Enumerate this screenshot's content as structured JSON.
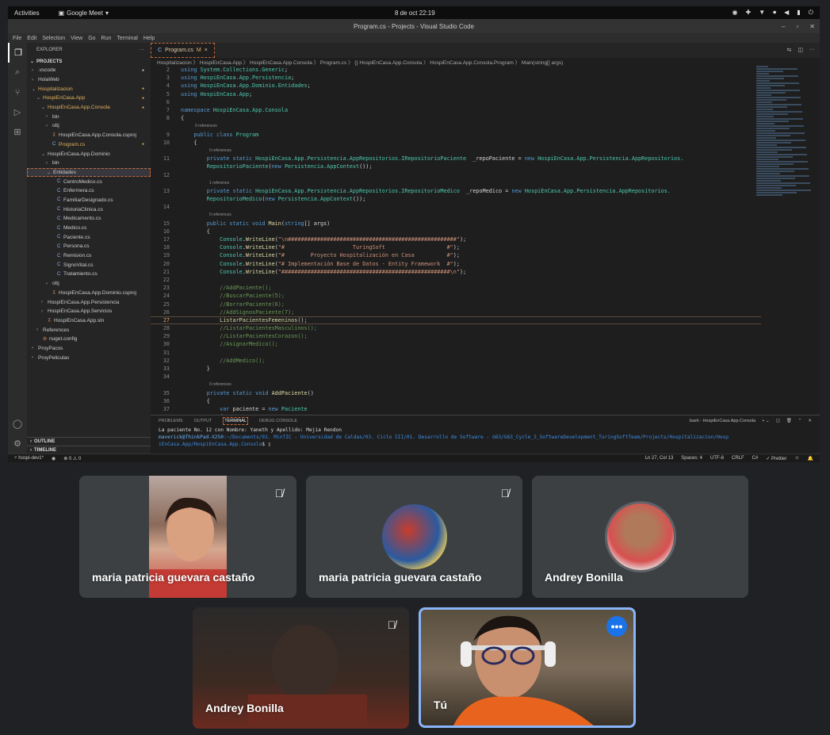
{
  "gnome": {
    "activities": "Activities",
    "app_name": "Google Meet",
    "clock": "8 de oct  22:19"
  },
  "window": {
    "title": "Program.cs - Projects - Visual Studio Code"
  },
  "menu": [
    "File",
    "Edit",
    "Selection",
    "View",
    "Go",
    "Run",
    "Terminal",
    "Help"
  ],
  "sidebar": {
    "header": "EXPLORER",
    "section": "PROJECTS",
    "items": [
      {
        "label": ".vscode",
        "indent": 1,
        "caret": "›",
        "icon": "",
        "color": "#ccc",
        "dot": true
      },
      {
        "label": "HolaWeb",
        "indent": 1,
        "caret": "›",
        "icon": "",
        "color": "#ccc",
        "dot": false
      },
      {
        "label": "Hospitalizacion",
        "indent": 1,
        "caret": "⌄",
        "icon": "",
        "color": "#e2b35c",
        "dot": true
      },
      {
        "label": "HospiEnCasa.App",
        "indent": 2,
        "caret": "⌄",
        "icon": "",
        "color": "#e2b35c",
        "dot": true
      },
      {
        "label": "HospiEnCasa.App.Consola",
        "indent": 3,
        "caret": "⌄",
        "icon": "",
        "color": "#e2b35c",
        "dot": true
      },
      {
        "label": "bin",
        "indent": 4,
        "caret": "›",
        "icon": "",
        "color": "#ccc",
        "dot": false
      },
      {
        "label": "obj",
        "indent": 4,
        "caret": "›",
        "icon": "",
        "color": "#ccc",
        "dot": false
      },
      {
        "label": "HospiEnCasa.App.Consola.csproj",
        "indent": 4,
        "caret": "",
        "icon": "⊼",
        "color": "#ccc",
        "dot": false
      },
      {
        "label": "Program.cs",
        "indent": 4,
        "caret": "",
        "icon": "C",
        "color": "#e2b35c",
        "dot": true
      },
      {
        "label": "HospiEnCasa.App.Dominio",
        "indent": 3,
        "caret": "⌄",
        "icon": "",
        "color": "#ccc",
        "dot": false
      },
      {
        "label": "bin",
        "indent": 4,
        "caret": "›",
        "icon": "",
        "color": "#ccc",
        "dot": false
      },
      {
        "label": "Entidades",
        "indent": 4,
        "caret": "⌄",
        "icon": "",
        "color": "#ccc",
        "dot": false,
        "sel": true
      },
      {
        "label": "CentroMedico.cs",
        "indent": 5,
        "caret": "",
        "icon": "C",
        "color": "#ccc",
        "dot": false
      },
      {
        "label": "Enfermera.cs",
        "indent": 5,
        "caret": "",
        "icon": "C",
        "color": "#ccc",
        "dot": false
      },
      {
        "label": "FamiliarDesignado.cs",
        "indent": 5,
        "caret": "",
        "icon": "C",
        "color": "#ccc",
        "dot": false
      },
      {
        "label": "HistoriaClinica.cs",
        "indent": 5,
        "caret": "",
        "icon": "C",
        "color": "#ccc",
        "dot": false
      },
      {
        "label": "Medicamento.cs",
        "indent": 5,
        "caret": "",
        "icon": "C",
        "color": "#ccc",
        "dot": false
      },
      {
        "label": "Medico.cs",
        "indent": 5,
        "caret": "",
        "icon": "C",
        "color": "#ccc",
        "dot": false
      },
      {
        "label": "Paciente.cs",
        "indent": 5,
        "caret": "",
        "icon": "C",
        "color": "#ccc",
        "dot": false
      },
      {
        "label": "Persona.cs",
        "indent": 5,
        "caret": "",
        "icon": "C",
        "color": "#ccc",
        "dot": false
      },
      {
        "label": "Remision.cs",
        "indent": 5,
        "caret": "",
        "icon": "C",
        "color": "#ccc",
        "dot": false
      },
      {
        "label": "SignoVital.cs",
        "indent": 5,
        "caret": "",
        "icon": "C",
        "color": "#ccc",
        "dot": false
      },
      {
        "label": "Tratamiento.cs",
        "indent": 5,
        "caret": "",
        "icon": "C",
        "color": "#ccc",
        "dot": false
      },
      {
        "label": "obj",
        "indent": 4,
        "caret": "›",
        "icon": "",
        "color": "#ccc",
        "dot": false
      },
      {
        "label": "HospiEnCasa.App.Dominio.csproj",
        "indent": 4,
        "caret": "",
        "icon": "⊼",
        "color": "#ccc",
        "dot": false
      },
      {
        "label": "HospiEnCasa.App.Persistencia",
        "indent": 3,
        "caret": "›",
        "icon": "",
        "color": "#ccc",
        "dot": false
      },
      {
        "label": "HospiEnCasa.App.Servicios",
        "indent": 3,
        "caret": "›",
        "icon": "",
        "color": "#ccc",
        "dot": false
      },
      {
        "label": "HospiEnCasa.App.sln",
        "indent": 3,
        "caret": "",
        "icon": "⊼",
        "color": "#ccc",
        "dot": false
      },
      {
        "label": "References",
        "indent": 2,
        "caret": "›",
        "icon": "",
        "color": "#ccc",
        "dot": false
      },
      {
        "label": "nuget.config",
        "indent": 2,
        "caret": "",
        "icon": "⚙",
        "color": "#ccc",
        "dot": false
      },
      {
        "label": "ProyPacos",
        "indent": 1,
        "caret": "›",
        "icon": "",
        "color": "#ccc",
        "dot": false
      },
      {
        "label": "ProyPeliculas",
        "indent": 1,
        "caret": "›",
        "icon": "",
        "color": "#ccc",
        "dot": false
      }
    ],
    "outline": "OUTLINE",
    "timeline": "TIMELINE"
  },
  "editor": {
    "tab_label": "Program.cs",
    "tab_mod": "M",
    "breadcrumb": "Hospitalizacion 〉 HospiEnCasa.App 〉 HospiEnCasa.App.Consola 〉 Program.cs 〉 {} HospiEnCasa.App.Consola 〉 HospiEnCasa.App.Consola.Program 〉 Main(string[] args)",
    "lines": [
      {
        "n": "2",
        "t": [
          [
            "kw",
            "using "
          ],
          [
            "ty",
            "System.Collections.Generic"
          ],
          [
            "",
            "; "
          ]
        ]
      },
      {
        "n": "3",
        "t": [
          [
            "kw",
            "using "
          ],
          [
            "ty",
            "HospiEnCasa.App.Persistencia"
          ],
          [
            "",
            ";"
          ]
        ]
      },
      {
        "n": "4",
        "t": [
          [
            "kw",
            "using "
          ],
          [
            "ty",
            "HospiEnCasa.App.Dominio.Entidades"
          ],
          [
            "",
            ";"
          ]
        ]
      },
      {
        "n": "5",
        "t": [
          [
            "kw",
            "using "
          ],
          [
            "ty",
            "HospiEnCasa.App"
          ],
          [
            "",
            ";"
          ]
        ]
      },
      {
        "n": "6",
        "t": [
          [
            "",
            ""
          ]
        ]
      },
      {
        "n": "7",
        "t": [
          [
            "kw",
            "namespace "
          ],
          [
            "ty",
            "HospiEnCasa.App.Consola"
          ]
        ]
      },
      {
        "n": "8",
        "t": [
          [
            "",
            "{"
          ]
        ]
      },
      {
        "n": "",
        "ref": "0 references",
        "pad": 3
      },
      {
        "n": "9",
        "t": [
          [
            "",
            "    "
          ],
          [
            "kw",
            "public class "
          ],
          [
            "ty",
            "Program"
          ]
        ]
      },
      {
        "n": "10",
        "t": [
          [
            "",
            "    {"
          ]
        ]
      },
      {
        "n": "",
        "ref": "0 references",
        "pad": 6
      },
      {
        "n": "11",
        "t": [
          [
            "",
            "        "
          ],
          [
            "kw",
            "private static "
          ],
          [
            "ty",
            "HospiEnCasa.App.Persistencia.AppRepositorios.IRepositorioPaciente"
          ],
          [
            "",
            "  _repoPaciente = "
          ],
          [
            "kw",
            "new "
          ],
          [
            "ty",
            "HospiEnCasa.App.Persistencia.AppRepositorios."
          ]
        ]
      },
      {
        "n": "",
        "t": [
          [
            "",
            "        "
          ],
          [
            "ty",
            "RepositorioPaciente"
          ],
          [
            "",
            "("
          ],
          [
            "kw",
            "new "
          ],
          [
            "ty",
            "Persistencia.AppContext"
          ],
          [
            "",
            "());"
          ]
        ]
      },
      {
        "n": "12",
        "t": [
          [
            "",
            ""
          ]
        ]
      },
      {
        "n": "",
        "ref": "1 reference",
        "pad": 6
      },
      {
        "n": "13",
        "t": [
          [
            "",
            "        "
          ],
          [
            "kw",
            "private static "
          ],
          [
            "ty",
            "HospiEnCasa.App.Persistencia.AppRepositorios.IRepositorioMedico"
          ],
          [
            "",
            "  _repoMedico = "
          ],
          [
            "kw",
            "new "
          ],
          [
            "ty",
            "HospiEnCasa.App.Persistencia.AppRepositorios."
          ]
        ]
      },
      {
        "n": "",
        "t": [
          [
            "",
            "        "
          ],
          [
            "ty",
            "RepositorioMedico"
          ],
          [
            "",
            "("
          ],
          [
            "kw",
            "new "
          ],
          [
            "ty",
            "Persistencia.AppContext"
          ],
          [
            "",
            "());"
          ]
        ]
      },
      {
        "n": "14",
        "t": [
          [
            "",
            ""
          ]
        ]
      },
      {
        "n": "",
        "ref": "0 references",
        "pad": 6
      },
      {
        "n": "15",
        "t": [
          [
            "",
            "        "
          ],
          [
            "kw",
            "public static void "
          ],
          [
            "fn",
            "Main"
          ],
          [
            "",
            "("
          ],
          [
            "kw",
            "string"
          ],
          [
            "",
            "[] args)"
          ]
        ]
      },
      {
        "n": "16",
        "t": [
          [
            "",
            "        {"
          ]
        ]
      },
      {
        "n": "17",
        "t": [
          [
            "",
            "            "
          ],
          [
            "ty",
            "Console"
          ],
          [
            "",
            "."
          ],
          [
            "fn",
            "WriteLine"
          ],
          [
            "",
            "("
          ],
          [
            "st",
            "\"\\n####################################################\""
          ],
          [
            "",
            ");"
          ]
        ]
      },
      {
        "n": "18",
        "t": [
          [
            "",
            "            "
          ],
          [
            "ty",
            "Console"
          ],
          [
            "",
            "."
          ],
          [
            "fn",
            "WriteLine"
          ],
          [
            "",
            "("
          ],
          [
            "st",
            "\"#                     TuringSoft                   #\""
          ],
          [
            "",
            ");"
          ]
        ]
      },
      {
        "n": "19",
        "t": [
          [
            "",
            "            "
          ],
          [
            "ty",
            "Console"
          ],
          [
            "",
            "."
          ],
          [
            "fn",
            "WriteLine"
          ],
          [
            "",
            "("
          ],
          [
            "st",
            "\"#        Proyecto Hospitalización en Casa          #\""
          ],
          [
            "",
            ");"
          ]
        ]
      },
      {
        "n": "20",
        "t": [
          [
            "",
            "            "
          ],
          [
            "ty",
            "Console"
          ],
          [
            "",
            "."
          ],
          [
            "fn",
            "WriteLine"
          ],
          [
            "",
            "("
          ],
          [
            "st",
            "\"# Implementación Base de Datos - Entity Framework  #\""
          ],
          [
            "",
            ");"
          ]
        ]
      },
      {
        "n": "21",
        "t": [
          [
            "",
            "            "
          ],
          [
            "ty",
            "Console"
          ],
          [
            "",
            "."
          ],
          [
            "fn",
            "WriteLine"
          ],
          [
            "",
            "("
          ],
          [
            "st",
            "\"####################################################\\n\""
          ],
          [
            "",
            ");"
          ]
        ]
      },
      {
        "n": "22",
        "t": [
          [
            "",
            ""
          ]
        ]
      },
      {
        "n": "23",
        "t": [
          [
            "",
            "            "
          ],
          [
            "cm",
            "//AddPaciente();"
          ]
        ]
      },
      {
        "n": "24",
        "t": [
          [
            "",
            "            "
          ],
          [
            "cm",
            "//BuscarPaciente(5);"
          ]
        ]
      },
      {
        "n": "25",
        "t": [
          [
            "",
            "            "
          ],
          [
            "cm",
            "//BorrarPaciente(6);"
          ]
        ]
      },
      {
        "n": "26",
        "t": [
          [
            "",
            "            "
          ],
          [
            "cm",
            "//AddSignosPaciente(7);"
          ]
        ]
      },
      {
        "n": "27",
        "t": [
          [
            "",
            "            "
          ],
          [
            "fn",
            "ListarPacientesFemeninos"
          ],
          [
            "",
            "();"
          ]
        ],
        "hl": true
      },
      {
        "n": "28",
        "t": [
          [
            "",
            "            "
          ],
          [
            "cm",
            "//ListarPacientesMasculinos();"
          ]
        ]
      },
      {
        "n": "29",
        "t": [
          [
            "",
            "            "
          ],
          [
            "cm",
            "//ListarPacientesCorazon();"
          ]
        ]
      },
      {
        "n": "30",
        "t": [
          [
            "",
            "            "
          ],
          [
            "cm",
            "//AsignarMedico();"
          ]
        ]
      },
      {
        "n": "31",
        "t": [
          [
            "",
            ""
          ]
        ]
      },
      {
        "n": "32",
        "t": [
          [
            "",
            "            "
          ],
          [
            "cm",
            "//AddMedico();"
          ]
        ]
      },
      {
        "n": "33",
        "t": [
          [
            "",
            "        }"
          ]
        ]
      },
      {
        "n": "34",
        "t": [
          [
            "",
            ""
          ]
        ]
      },
      {
        "n": "",
        "ref": "0 references",
        "pad": 6
      },
      {
        "n": "35",
        "t": [
          [
            "",
            "        "
          ],
          [
            "kw",
            "private static void "
          ],
          [
            "fn",
            "AddPaciente"
          ],
          [
            "",
            "()"
          ]
        ]
      },
      {
        "n": "36",
        "t": [
          [
            "",
            "        {"
          ]
        ]
      },
      {
        "n": "37",
        "t": [
          [
            "",
            "            "
          ],
          [
            "kw",
            "var "
          ],
          [
            "",
            "paciente = "
          ],
          [
            "kw",
            "new "
          ],
          [
            "ty",
            "Paciente"
          ]
        ]
      },
      {
        "n": "38",
        "t": [
          [
            "",
            "            {"
          ]
        ]
      }
    ]
  },
  "panel": {
    "tabs": [
      "PROBLEMS",
      "OUTPUT",
      "TERMINAL",
      "DEBUG CONSOLE"
    ],
    "active_tab": "TERMINAL",
    "shell": "bash - HospiEnCasa.App.Consola",
    "out_line": "La paciente No. 12 con Nombre: Yaneth y Apellido: Mejia Rendon",
    "prompt_user": "maverick@ThinkPad-X250",
    "prompt_path": ":~/Documents/01. MinTIC - Universidad de Caldas/03. Ciclo III/01. Desarrollo de Software - G63/G63_Cycle_3_SoftwareDevelopment_TuringSoftTeam/Projects/Hospitalizacion/Hosp",
    "prompt_path2": "iEnCasa.App/HospiEnCasa.App.Consola",
    "prompt_end": "$ "
  },
  "status": {
    "branch": "hospi-dev1*",
    "errors": "⊗ 0 ⚠ 0",
    "position": "Ln 27, Col 13",
    "spaces": "Spaces: 4",
    "encoding": "UTF-8",
    "eol": "CRLF",
    "lang": "C#",
    "prettier": "✓ Prettier"
  },
  "participants": [
    {
      "name": "maria patricia guevara castaño",
      "muted": true
    },
    {
      "name": "maria patricia guevara castaño",
      "muted": true
    },
    {
      "name": "Andrey Bonilla",
      "muted": false
    },
    {
      "name": "Andrey Bonilla",
      "muted": true
    },
    {
      "name": "Tú",
      "muted": false
    }
  ]
}
